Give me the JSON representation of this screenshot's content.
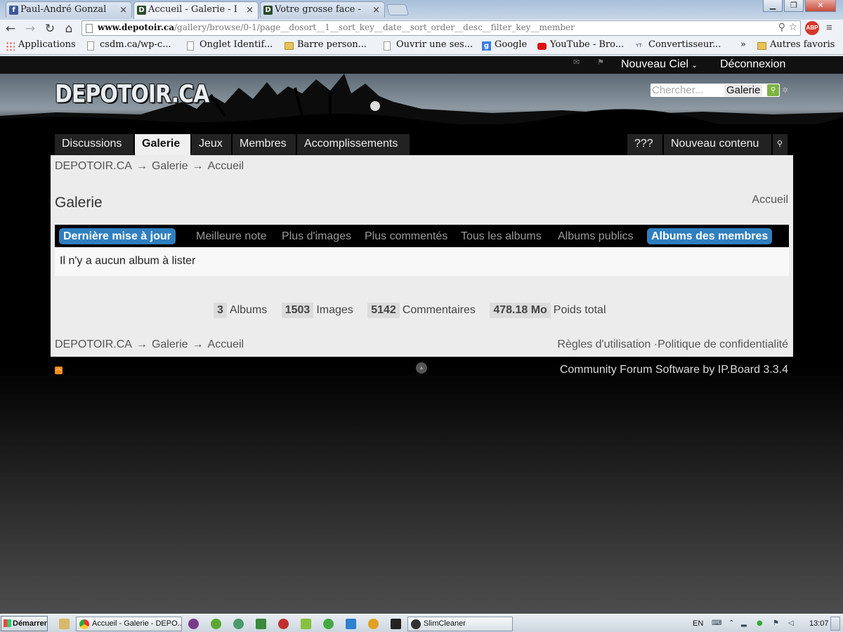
{
  "browser": {
    "tabs": [
      {
        "label": "Paul-André Gonzal",
        "favicon": "f",
        "favicon_color": "#3b5998"
      },
      {
        "label": "Accueil - Galerie - I",
        "favicon": "D",
        "favicon_color": "#2b4a2b"
      },
      {
        "label": "Votre grosse face -",
        "favicon": "D",
        "favicon_color": "#2b4a2b"
      }
    ],
    "url_domain": "www.depotoir.ca",
    "url_path": "/gallery/browse/0-1/page__dosort__1__sort_key__date__sort_order__desc__filter_key__member",
    "abp_label": "ABP",
    "bookmarks": [
      {
        "label": "Applications",
        "icon": "apps-grid"
      },
      {
        "label": "csdm.ca/wp-c...",
        "icon": "page"
      },
      {
        "label": "Onglet Identif...",
        "icon": "page"
      },
      {
        "label": "Barre person...",
        "icon": "folder"
      },
      {
        "label": "Ouvrir une ses...",
        "icon": "page"
      },
      {
        "label": "Google",
        "icon": "google"
      },
      {
        "label": "YouTube - Bro...",
        "icon": "youtube"
      },
      {
        "label": "Convertisseur...",
        "icon": "mp3"
      },
      {
        "label": "»",
        "icon": "none"
      },
      {
        "label": "Autres favoris",
        "icon": "folder"
      }
    ]
  },
  "site": {
    "user_name": "Nouveau Ciel",
    "logout": "Déconnexion",
    "logo": "DEPOTOIR.CA",
    "search": {
      "placeholder": "Chercher...",
      "scope": "Galerie"
    },
    "nav": [
      "Discussions",
      "Galerie",
      "Jeux",
      "Membres",
      "Accomplissements"
    ],
    "nav_active": "Galerie",
    "nav_right": [
      "???",
      "Nouveau contenu"
    ],
    "breadcrumb": [
      "DEPOTOIR.CA",
      "Galerie",
      "Accueil"
    ],
    "breadcrumb_sep": "→",
    "page_title": "Galerie",
    "page_home_link": "Accueil",
    "filters": [
      "Dernière mise à jour",
      "Meilleure note",
      "Plus d'images",
      "Plus commentés",
      "Tous les albums",
      "Albums publics",
      "Albums des membres"
    ],
    "filters_active": [
      "Dernière mise à jour",
      "Albums des membres"
    ],
    "empty_message": "Il n'y a aucun album à lister",
    "stats": [
      {
        "value": "3",
        "label": "Albums"
      },
      {
        "value": "1503",
        "label": "Images"
      },
      {
        "value": "5142",
        "label": "Commentaires"
      },
      {
        "value": "478.18 Mo",
        "label": "Poids total"
      }
    ],
    "footer_links": [
      "Règles d'utilisation",
      "·Politique de confidentialité"
    ],
    "copyright": "Community Forum Software by IP.Board 3.3.4",
    "colors": {
      "accent": "#2f7fbf",
      "background": "#000000",
      "content": "#ececec"
    }
  },
  "taskbar": {
    "start": "Démarrer",
    "tasks": [
      "Accueil - Galerie - DEPO...",
      "SlimCleaner"
    ],
    "lang": "EN",
    "clock": "13:07"
  }
}
